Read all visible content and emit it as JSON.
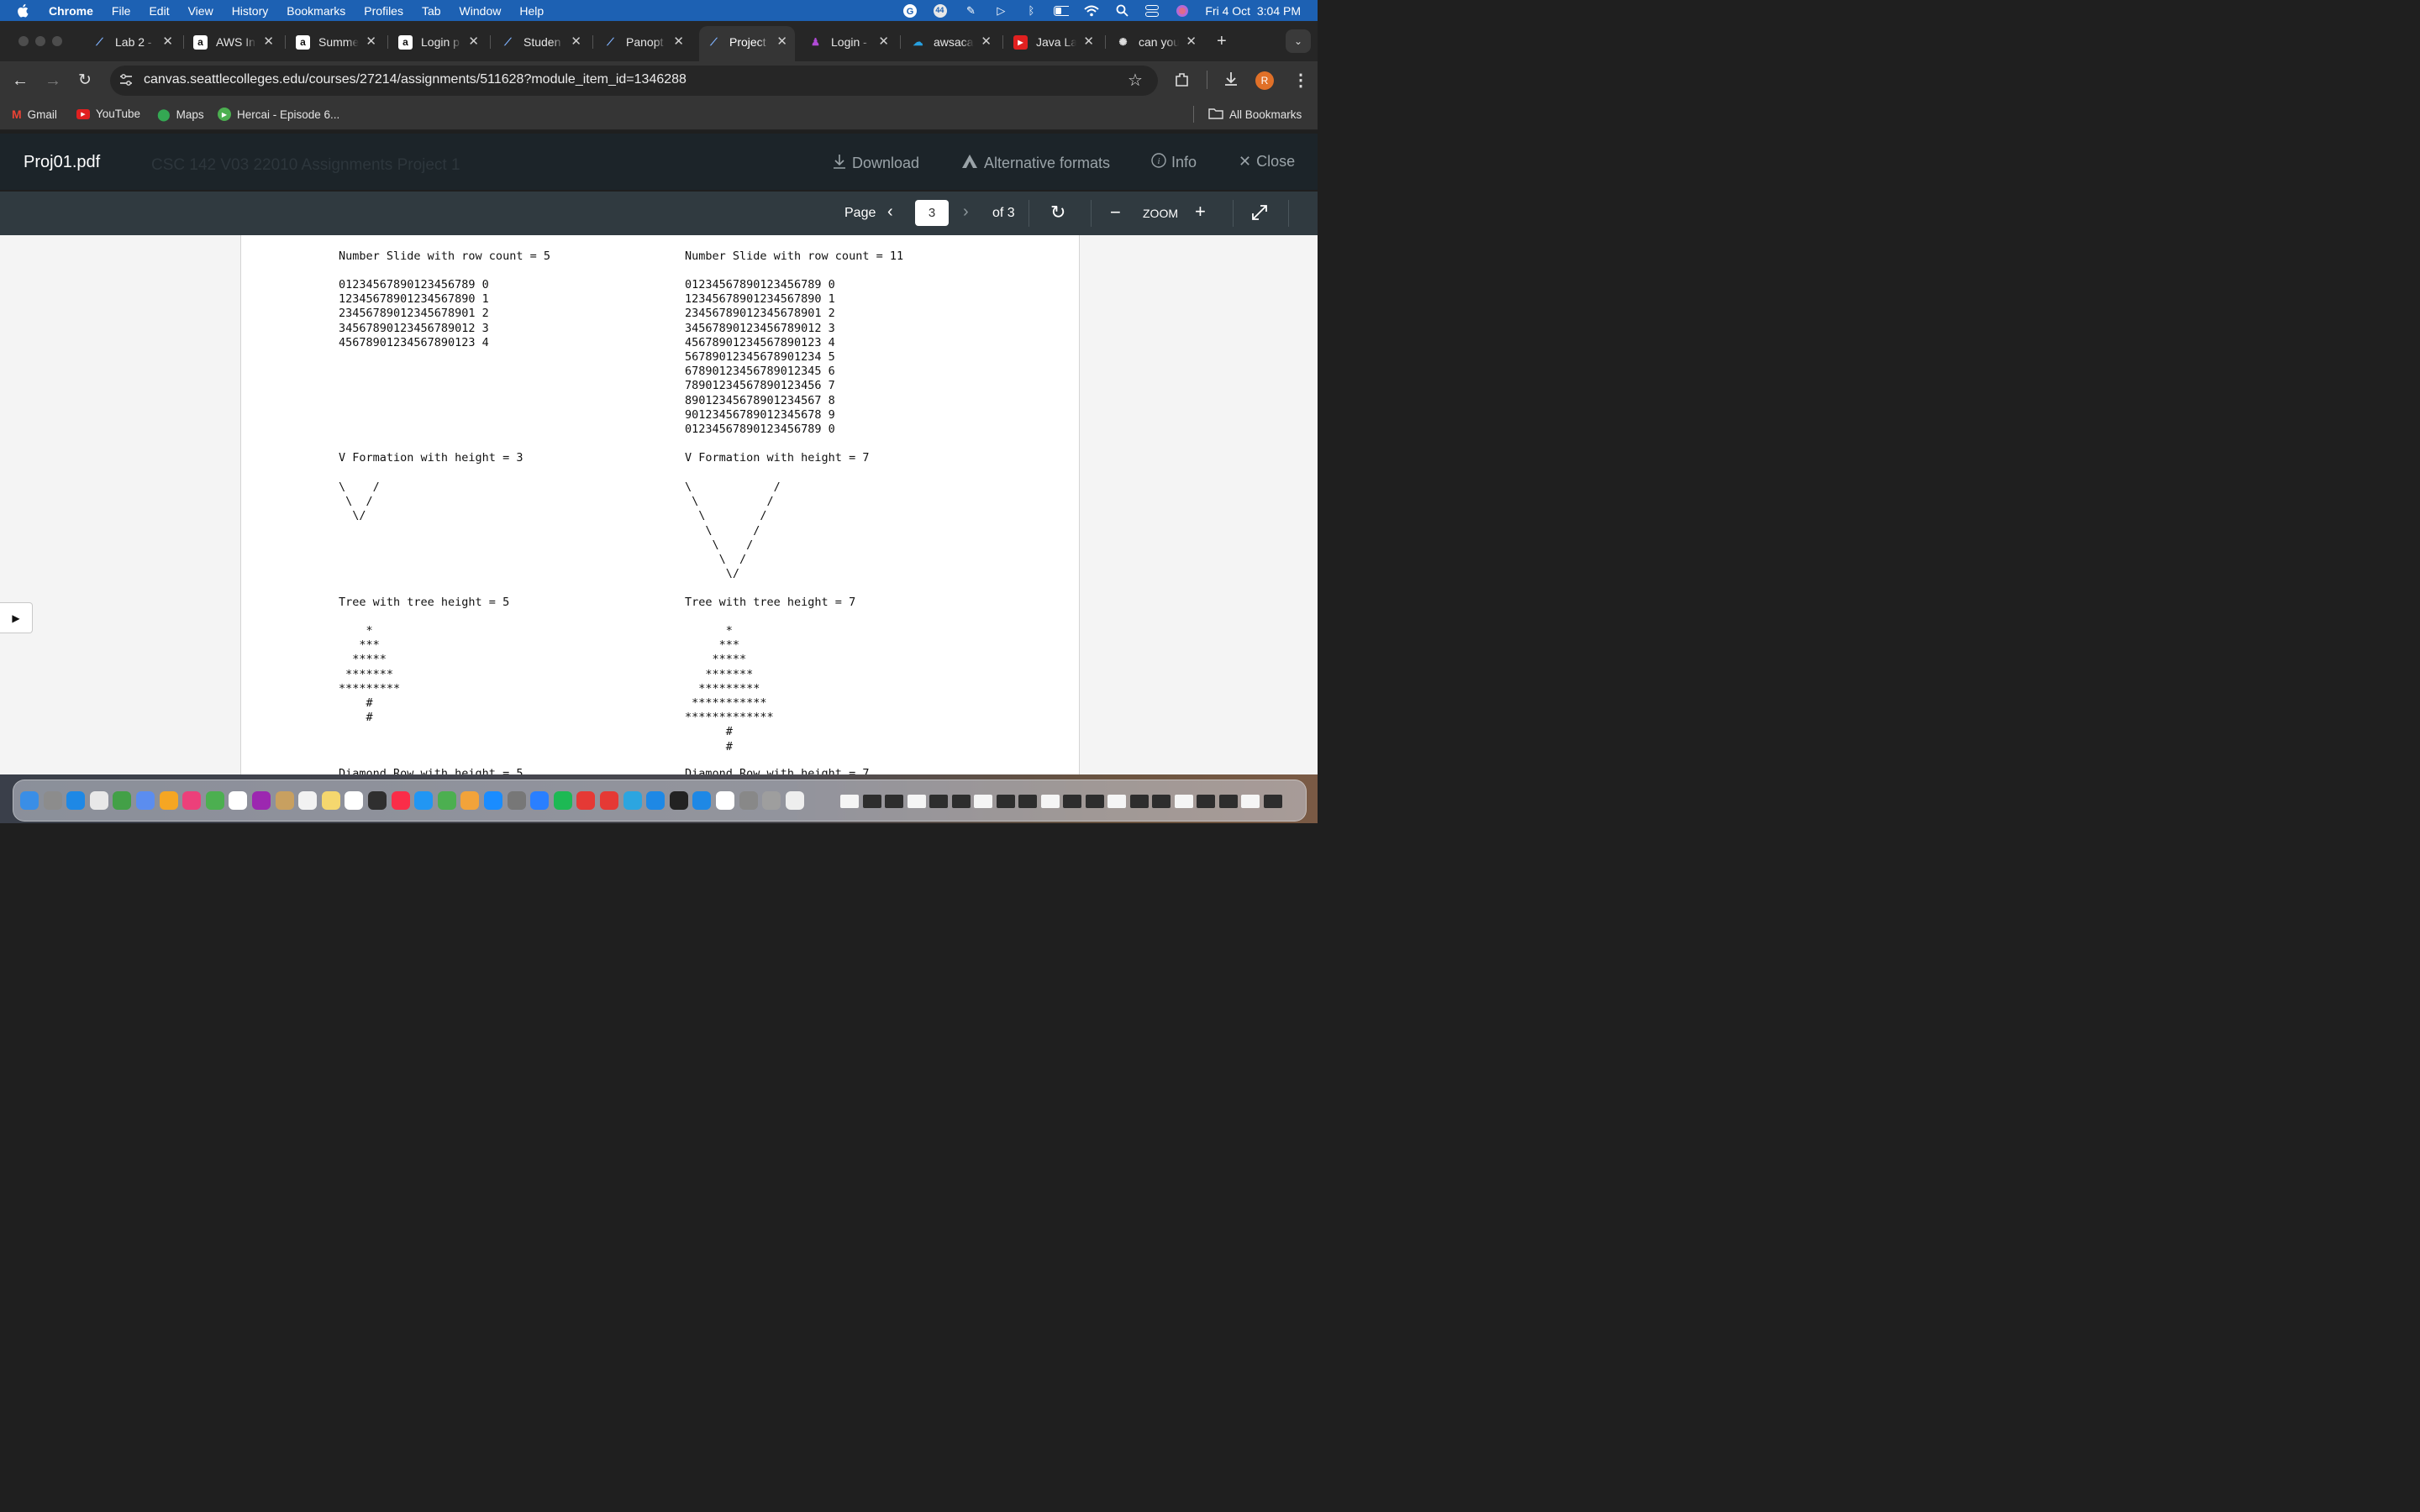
{
  "menubar": {
    "app": "Chrome",
    "items": [
      "File",
      "Edit",
      "View",
      "History",
      "Bookmarks",
      "Profiles",
      "Tab",
      "Window",
      "Help"
    ],
    "clock": "Fri 4 Oct  3:04 PM",
    "badge": "44"
  },
  "tabs": [
    {
      "title": "Lab 2 -",
      "icon": "canvas-icon"
    },
    {
      "title": "AWS In",
      "icon": "amazon-icon"
    },
    {
      "title": "Summe",
      "icon": "amazon-icon"
    },
    {
      "title": "Login p",
      "icon": "amazon-icon"
    },
    {
      "title": "Studen",
      "icon": "canvas-icon"
    },
    {
      "title": "Panopt",
      "icon": "canvas-icon"
    },
    {
      "title": "Project",
      "icon": "canvas-icon",
      "active": true
    },
    {
      "title": "Login -",
      "icon": "figure-icon"
    },
    {
      "title": "awsaca",
      "icon": "cloud-icon"
    },
    {
      "title": "Java La",
      "icon": "youtube-icon"
    },
    {
      "title": "can you",
      "icon": "ai-icon"
    }
  ],
  "address": {
    "url": "canvas.seattlecolleges.edu/courses/27214/assignments/511628?module_item_id=1346288"
  },
  "profile_initial": "R",
  "bookmarks": [
    {
      "label": "Gmail",
      "icon": "gmail-icon"
    },
    {
      "label": "YouTube",
      "icon": "youtube-icon"
    },
    {
      "label": "Maps",
      "icon": "maps-icon"
    },
    {
      "label": "Hercai - Episode 6...",
      "icon": "play-icon"
    }
  ],
  "all_bookmarks": "All Bookmarks",
  "viewer_header": {
    "file": "Proj01.pdf",
    "ghost_breadcrumb": "CSC 142 V03 22010    Assignments    Project 1",
    "download": "Download",
    "alt_formats": "Alternative formats",
    "info": "Info",
    "close": "Close"
  },
  "pdf_toolbar": {
    "page_label": "Page",
    "page": "3",
    "of": "of 3",
    "zoom": "ZOOM"
  },
  "document": {
    "left": {
      "slide_title": "Number Slide with row count = 5",
      "slide": "01234567890123456789 0\n12345678901234567890 1\n23456789012345678901 2\n34567890123456789012 3\n45678901234567890123 4",
      "v_title": "V Formation with height = 3",
      "v": "\\    /\n \\  /\n  \\/",
      "tree_title": "Tree with tree height = 5",
      "tree": "    *\n   ***\n  *****\n *******\n*********\n    #\n    #",
      "next_title": "Diamond Row with height = 5"
    },
    "right": {
      "slide_title": "Number Slide with row count = 11",
      "slide": "01234567890123456789 0\n12345678901234567890 1\n23456789012345678901 2\n34567890123456789012 3\n45678901234567890123 4\n56789012345678901234 5\n67890123456789012345 6\n78901234567890123456 7\n89012345678901234567 8\n90123456789012345678 9\n01234567890123456789 0",
      "v_title": "V Formation with height = 7",
      "v": "\\            /\n \\          /\n  \\        /\n   \\      /\n    \\    /\n     \\  /\n      \\/",
      "tree_title": "Tree with tree height = 7",
      "tree": "      *\n     ***\n    *****\n   *******\n  *********\n ***********\n*************\n      #\n      #",
      "next_title": "Diamond Row with height = 7"
    }
  },
  "dock_badge_calendar": "4",
  "colors": {
    "menubar": "#1d61b3",
    "canvas_header": "#1c2429",
    "pdf_toolbar": "#303a40"
  }
}
